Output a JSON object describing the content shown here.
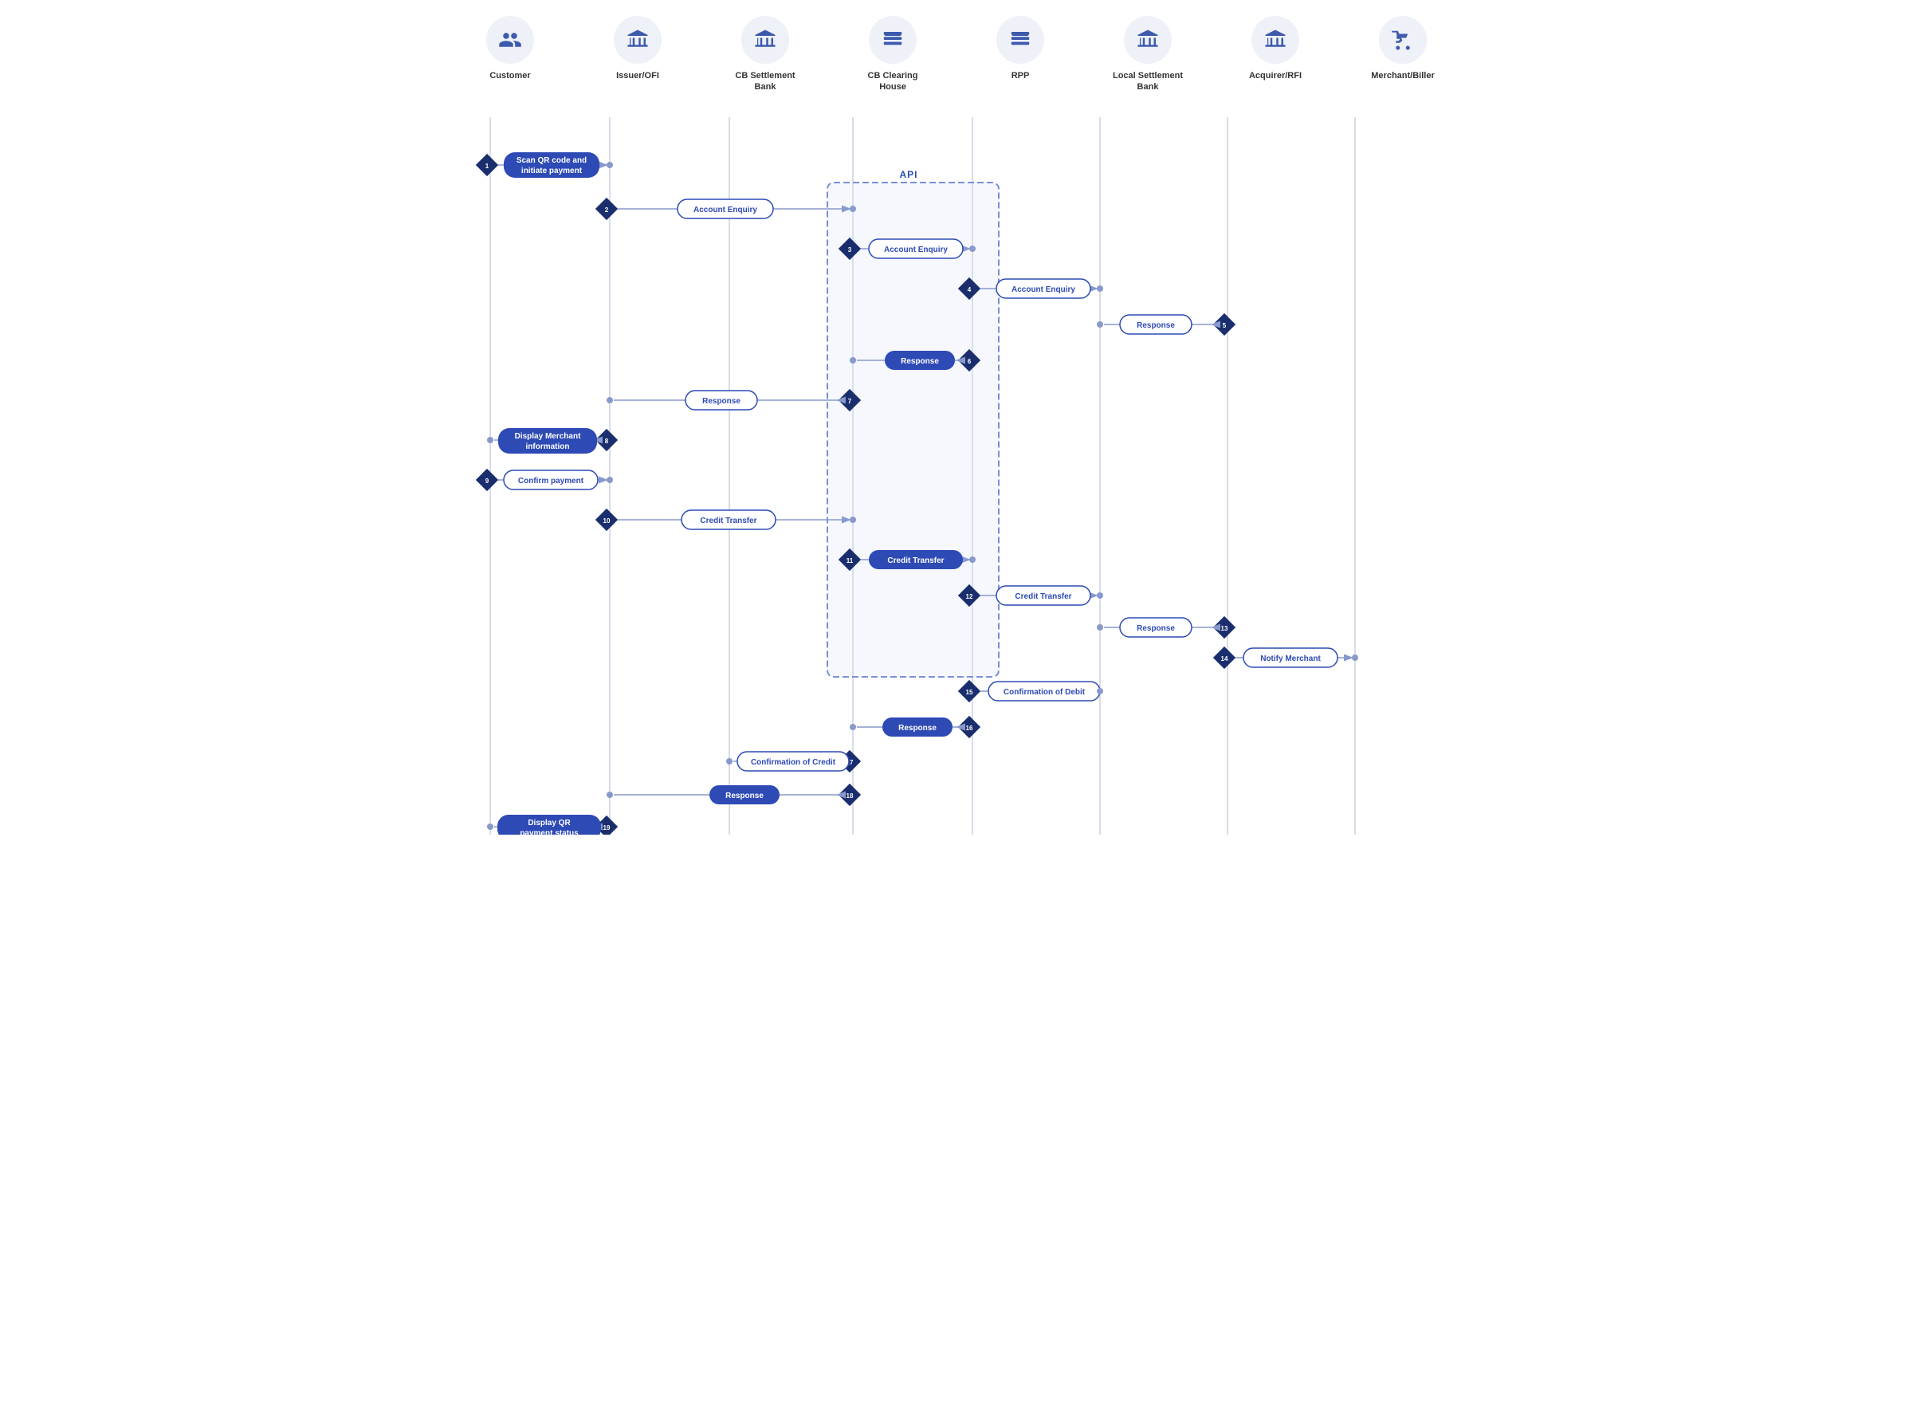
{
  "actors": [
    {
      "id": "customer",
      "label": "Customer",
      "icon": "people"
    },
    {
      "id": "issuer",
      "label": "Issuer/OFI",
      "icon": "bank"
    },
    {
      "id": "cb_settlement",
      "label": "CB Settlement\nBank",
      "icon": "bank"
    },
    {
      "id": "cb_clearing",
      "label": "CB Clearing\nHouse",
      "icon": "stack"
    },
    {
      "id": "rpp",
      "label": "RPP",
      "icon": "stack"
    },
    {
      "id": "local_settlement",
      "label": "Local Settlement\nBank",
      "icon": "bank"
    },
    {
      "id": "acquirer",
      "label": "Acquirer/RFI",
      "icon": "bank"
    },
    {
      "id": "merchant",
      "label": "Merchant/Biller",
      "icon": "cart"
    }
  ],
  "steps": [
    {
      "num": "1",
      "label": "Scan QR code and\ninitiate payment",
      "style": "filled",
      "direction": "right",
      "from": "customer",
      "to": "issuer"
    },
    {
      "num": "2",
      "label": "Account Enquiry",
      "style": "outlined",
      "direction": "right",
      "from": "issuer",
      "to": "cb_clearing"
    },
    {
      "num": "3",
      "label": "Account Enquiry",
      "style": "outlined",
      "direction": "right",
      "from": "cb_clearing",
      "to": "rpp"
    },
    {
      "num": "4",
      "label": "Account Enquiry",
      "style": "outlined",
      "direction": "right",
      "from": "rpp",
      "to": "local_settlement"
    },
    {
      "num": "5",
      "label": "Response",
      "style": "outlined",
      "direction": "left",
      "from": "acquirer",
      "to": "rpp"
    },
    {
      "num": "6",
      "label": "Response",
      "style": "filled",
      "direction": "left",
      "from": "rpp",
      "to": "cb_clearing"
    },
    {
      "num": "7",
      "label": "Response",
      "style": "outlined",
      "direction": "left",
      "from": "cb_clearing",
      "to": "issuer"
    },
    {
      "num": "8",
      "label": "Display Merchant\ninformation",
      "style": "filled",
      "direction": "left",
      "from": "issuer",
      "to": "customer"
    },
    {
      "num": "9",
      "label": "Confirm payment",
      "style": "outlined",
      "direction": "right",
      "from": "customer",
      "to": "issuer"
    },
    {
      "num": "10",
      "label": "Credit Transfer",
      "style": "outlined",
      "direction": "right",
      "from": "issuer",
      "to": "cb_clearing"
    },
    {
      "num": "11",
      "label": "Credit Transfer",
      "style": "filled",
      "direction": "right",
      "from": "cb_clearing",
      "to": "rpp"
    },
    {
      "num": "12",
      "label": "Credit Transfer",
      "style": "outlined",
      "direction": "right",
      "from": "rpp",
      "to": "local_settlement"
    },
    {
      "num": "13",
      "label": "Response",
      "style": "outlined",
      "direction": "left",
      "from": "acquirer",
      "to": "rpp"
    },
    {
      "num": "14",
      "label": "Notify Merchant",
      "style": "outlined",
      "direction": "right",
      "from": "acquirer",
      "to": "merchant"
    },
    {
      "num": "15",
      "label": "Confirmation of Debit",
      "style": "outlined",
      "direction": "right",
      "from": "rpp",
      "to": "local_settlement"
    },
    {
      "num": "16",
      "label": "Response",
      "style": "filled",
      "direction": "left",
      "from": "rpp",
      "to": "cb_clearing"
    },
    {
      "num": "17",
      "label": "Confirmation of Credit",
      "style": "outlined",
      "direction": "left",
      "from": "cb_clearing",
      "to": "cb_settlement"
    },
    {
      "num": "18",
      "label": "Response",
      "style": "filled",
      "direction": "left",
      "from": "cb_clearing",
      "to": "issuer"
    },
    {
      "num": "19",
      "label": "Display QR\npayment status",
      "style": "filled",
      "direction": "left",
      "from": "issuer",
      "to": "customer"
    }
  ],
  "api_label": "API"
}
